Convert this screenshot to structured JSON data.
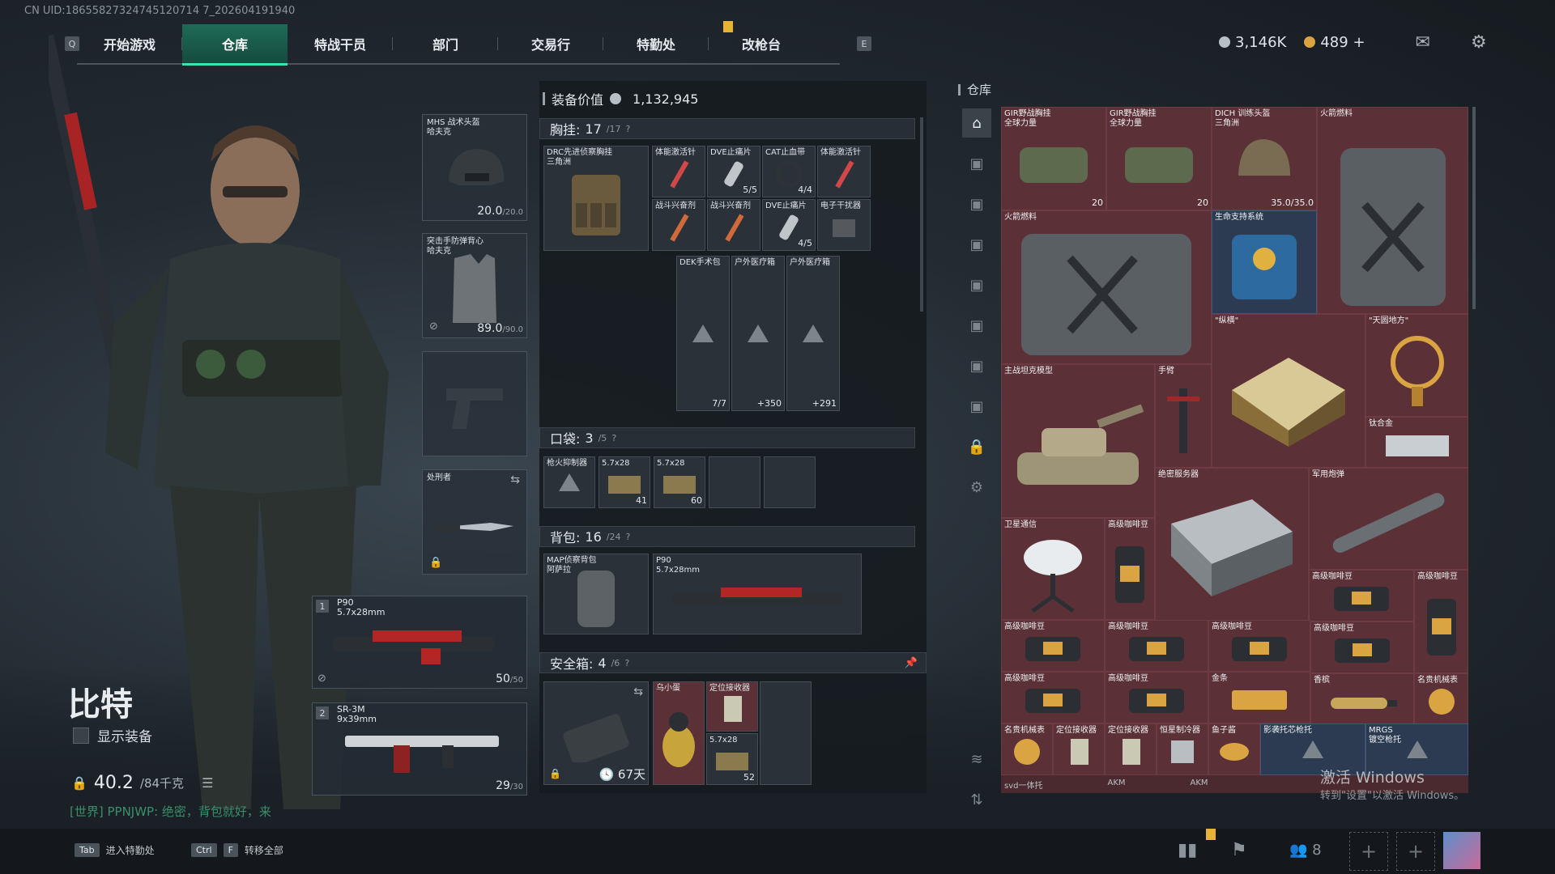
{
  "uid": "CN UID:18655827324745120714 7_202604191940",
  "nav": {
    "key_left": "Q",
    "tabs": [
      "开始游戏",
      "仓库",
      "特战干员",
      "部门",
      "交易行",
      "特勤处",
      "改枪台"
    ],
    "active": "仓库",
    "key_right": "E"
  },
  "currency": {
    "silver": "3,146K",
    "gold": "489",
    "plus": "+"
  },
  "character": {
    "name": "比特",
    "show_gear": "显示装备",
    "weight": "40.2",
    "weight_max": "/84千克",
    "chat": "[世界] PPNJWP: 绝密，背包就好，来"
  },
  "equip": {
    "helmet": {
      "label1": "MHS 战术头盔",
      "label2": "哈夫克",
      "value": "20.0",
      "max": "/20.0"
    },
    "armor": {
      "label1": "突击手防弹背心",
      "label2": "哈夫克",
      "value": "89.0",
      "max": "/90.0"
    },
    "melee": {
      "label": "处刑者"
    },
    "weapon1": {
      "index": "1",
      "name": "P90",
      "caliber": "5.7x28mm",
      "ammo": "50",
      "max": "/50"
    },
    "weapon2": {
      "index": "2",
      "name": "SR-3M",
      "caliber": "9x39mm",
      "ammo": "29",
      "max": "/30"
    }
  },
  "center": {
    "value_label": "装备价值",
    "value": "1,132,945",
    "chest": {
      "title": "胸挂:",
      "count": "17",
      "max": "/17",
      "rig": "DRC先进侦察胸挂",
      "rig_sub": "三角洲"
    },
    "chest_items": [
      {
        "label": "体能激活针",
        "count": ""
      },
      {
        "label": "DVE止痛片",
        "count": "5/5"
      },
      {
        "label": "CAT止血带",
        "count": "4/4"
      },
      {
        "label": "体能激活针",
        "count": ""
      },
      {
        "label": "战斗兴奋剂",
        "count": ""
      },
      {
        "label": "战斗兴奋剂",
        "count": ""
      },
      {
        "label": "DVE止痛片",
        "count": "4/5"
      },
      {
        "label": "电子干扰器",
        "count": ""
      }
    ],
    "med_items": [
      {
        "label": "DEK手术包",
        "count": "7/7"
      },
      {
        "label": "户外医疗箱",
        "count": "+350"
      },
      {
        "label": "户外医疗箱",
        "count": "+291"
      }
    ],
    "pocket": {
      "title": "口袋:",
      "count": "3",
      "max": "/5"
    },
    "pocket_items": [
      {
        "label": "枪火抑制器",
        "count": ""
      },
      {
        "label": "5.7x28",
        "count": "41"
      },
      {
        "label": "5.7x28",
        "count": "60"
      }
    ],
    "backpack": {
      "title": "背包:",
      "count": "16",
      "max": "/24",
      "bag": "MAP侦察背包",
      "bag_sub": "阿萨拉",
      "gun": "P90",
      "gun_cal": "5.7x28mm"
    },
    "safe": {
      "title": "安全箱:",
      "count": "4",
      "max": "/6",
      "days": "67天"
    },
    "safe_items": [
      {
        "label": "乌小蛋",
        "count": ""
      },
      {
        "label": "定位接收器",
        "count": ""
      },
      {
        "label": "5.7x28",
        "count": "52"
      }
    ]
  },
  "warehouse": {
    "title": "仓库",
    "items": [
      {
        "label": "GIR野战胸挂",
        "sub": "全球力量",
        "count": "20"
      },
      {
        "label": "GIR野战胸挂",
        "sub": "全球力量",
        "count": "20"
      },
      {
        "label": "DICH 训练头盔",
        "sub": "三角洲",
        "count": "35.0/35.0"
      },
      {
        "label": "火箭燃料",
        "sub": "",
        "count": ""
      },
      {
        "label": "火箭燃料",
        "sub": "",
        "count": ""
      },
      {
        "label": "生命支持系统",
        "sub": "",
        "count": ""
      },
      {
        "label": "\"纵横\"",
        "sub": "",
        "count": ""
      },
      {
        "label": "\"天圆地方\"",
        "sub": "",
        "count": ""
      },
      {
        "label": "主战坦克模型",
        "sub": "",
        "count": ""
      },
      {
        "label": "手臂",
        "sub": "",
        "count": ""
      },
      {
        "label": "钛合金",
        "sub": "",
        "count": ""
      },
      {
        "label": "绝密服务器",
        "sub": "",
        "count": ""
      },
      {
        "label": "军用炮弹",
        "sub": "",
        "count": ""
      },
      {
        "label": "卫星通信",
        "sub": "",
        "count": ""
      },
      {
        "label": "高级咖啡豆",
        "sub": "",
        "count": ""
      },
      {
        "label": "高级咖啡豆",
        "sub": "",
        "count": ""
      },
      {
        "label": "高级咖啡豆",
        "sub": "",
        "count": ""
      },
      {
        "label": "高级咖啡豆",
        "sub": "",
        "count": ""
      },
      {
        "label": "高级咖啡豆",
        "sub": "",
        "count": ""
      },
      {
        "label": "高级咖啡豆",
        "sub": "",
        "count": ""
      },
      {
        "label": "高级咖啡豆",
        "sub": "",
        "count": ""
      },
      {
        "label": "高级咖啡豆",
        "sub": "",
        "count": ""
      },
      {
        "label": "高级咖啡豆",
        "sub": "",
        "count": ""
      },
      {
        "label": "金条",
        "sub": "",
        "count": ""
      },
      {
        "label": "香槟",
        "sub": "",
        "count": ""
      },
      {
        "label": "名贵机械表",
        "sub": "",
        "count": ""
      },
      {
        "label": "名贵机械表",
        "sub": "",
        "count": ""
      },
      {
        "label": "定位接收器",
        "sub": "",
        "count": ""
      },
      {
        "label": "定位接收器",
        "sub": "",
        "count": ""
      },
      {
        "label": "恒星制冷器",
        "sub": "",
        "count": ""
      },
      {
        "label": "鱼子酱",
        "sub": "",
        "count": ""
      },
      {
        "label": "影袭托芯枪托",
        "sub": "",
        "count": ""
      },
      {
        "label": "MRGS",
        "sub": "镀空枪托",
        "count": ""
      }
    ],
    "bottom_row": [
      "svd一体托",
      "AKM",
      "AKM"
    ]
  },
  "bottom": {
    "hint1_key": "Tab",
    "hint1": "进入特勤处",
    "hint2_key": "Ctrl",
    "hint2_key2": "F",
    "hint2": "转移全部",
    "friends": "8"
  },
  "watermark": {
    "line1": "激活 Windows",
    "line2": "转到\"设置\"以激活 Windows。"
  },
  "colors": {
    "accent": "#3fe0b0",
    "red_rarity": "#5b3036",
    "blue_rarity": "#2c3b52"
  }
}
